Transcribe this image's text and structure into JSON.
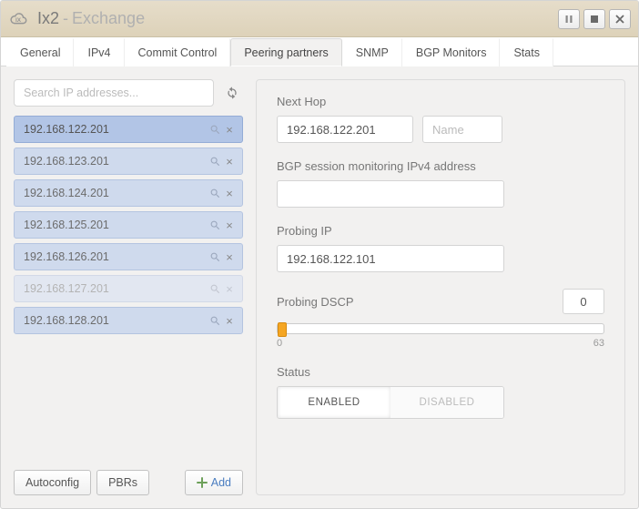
{
  "title": {
    "main": "Ix2",
    "sub": "Exchange",
    "separator": " - "
  },
  "tabs": [
    "General",
    "IPv4",
    "Commit Control",
    "Peering partners",
    "SNMP",
    "BGP Monitors",
    "Stats"
  ],
  "active_tab": "Peering partners",
  "search": {
    "placeholder": "Search IP addresses..."
  },
  "ip_items": [
    {
      "ip": "192.168.122.201",
      "state": "selected"
    },
    {
      "ip": "192.168.123.201",
      "state": "normal"
    },
    {
      "ip": "192.168.124.201",
      "state": "normal"
    },
    {
      "ip": "192.168.125.201",
      "state": "normal"
    },
    {
      "ip": "192.168.126.201",
      "state": "normal"
    },
    {
      "ip": "192.168.127.201",
      "state": "muted"
    },
    {
      "ip": "192.168.128.201",
      "state": "normal"
    }
  ],
  "left_footer": {
    "autoconfig": "Autoconfig",
    "pbrs": "PBRs",
    "add": "Add"
  },
  "form": {
    "next_hop_label": "Next Hop",
    "next_hop_ip": "192.168.122.201",
    "next_hop_name_placeholder": "Name",
    "bgp_label": "BGP session monitoring IPv4 address",
    "bgp_value": "",
    "probing_ip_label": "Probing IP",
    "probing_ip_value": "192.168.122.101",
    "dscp_label": "Probing DSCP",
    "dscp_value": "0",
    "dscp_min": "0",
    "dscp_max": "63",
    "status_label": "Status",
    "status_enabled": "ENABLED",
    "status_disabled": "DISABLED",
    "status_active": "ENABLED"
  }
}
